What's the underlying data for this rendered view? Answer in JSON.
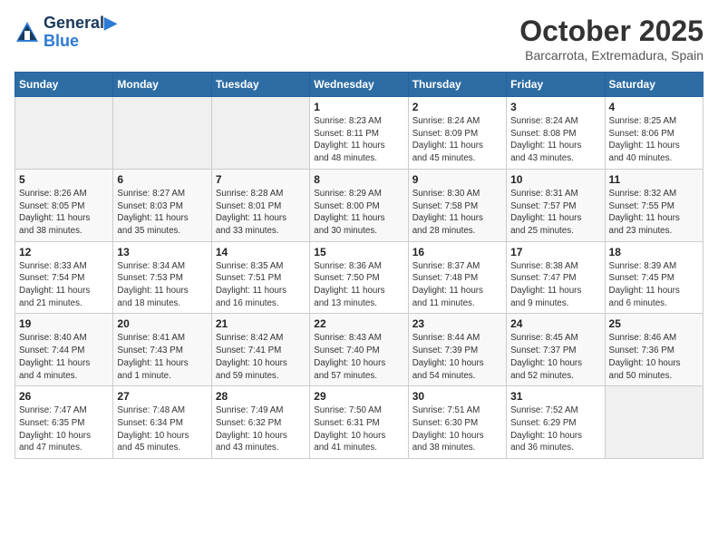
{
  "header": {
    "logo_line1": "General",
    "logo_line2": "Blue",
    "month": "October 2025",
    "location": "Barcarrota, Extremadura, Spain"
  },
  "days_of_week": [
    "Sunday",
    "Monday",
    "Tuesday",
    "Wednesday",
    "Thursday",
    "Friday",
    "Saturday"
  ],
  "weeks": [
    [
      {
        "day": "",
        "info": ""
      },
      {
        "day": "",
        "info": ""
      },
      {
        "day": "",
        "info": ""
      },
      {
        "day": "1",
        "info": "Sunrise: 8:23 AM\nSunset: 8:11 PM\nDaylight: 11 hours\nand 48 minutes."
      },
      {
        "day": "2",
        "info": "Sunrise: 8:24 AM\nSunset: 8:09 PM\nDaylight: 11 hours\nand 45 minutes."
      },
      {
        "day": "3",
        "info": "Sunrise: 8:24 AM\nSunset: 8:08 PM\nDaylight: 11 hours\nand 43 minutes."
      },
      {
        "day": "4",
        "info": "Sunrise: 8:25 AM\nSunset: 8:06 PM\nDaylight: 11 hours\nand 40 minutes."
      }
    ],
    [
      {
        "day": "5",
        "info": "Sunrise: 8:26 AM\nSunset: 8:05 PM\nDaylight: 11 hours\nand 38 minutes."
      },
      {
        "day": "6",
        "info": "Sunrise: 8:27 AM\nSunset: 8:03 PM\nDaylight: 11 hours\nand 35 minutes."
      },
      {
        "day": "7",
        "info": "Sunrise: 8:28 AM\nSunset: 8:01 PM\nDaylight: 11 hours\nand 33 minutes."
      },
      {
        "day": "8",
        "info": "Sunrise: 8:29 AM\nSunset: 8:00 PM\nDaylight: 11 hours\nand 30 minutes."
      },
      {
        "day": "9",
        "info": "Sunrise: 8:30 AM\nSunset: 7:58 PM\nDaylight: 11 hours\nand 28 minutes."
      },
      {
        "day": "10",
        "info": "Sunrise: 8:31 AM\nSunset: 7:57 PM\nDaylight: 11 hours\nand 25 minutes."
      },
      {
        "day": "11",
        "info": "Sunrise: 8:32 AM\nSunset: 7:55 PM\nDaylight: 11 hours\nand 23 minutes."
      }
    ],
    [
      {
        "day": "12",
        "info": "Sunrise: 8:33 AM\nSunset: 7:54 PM\nDaylight: 11 hours\nand 21 minutes."
      },
      {
        "day": "13",
        "info": "Sunrise: 8:34 AM\nSunset: 7:53 PM\nDaylight: 11 hours\nand 18 minutes."
      },
      {
        "day": "14",
        "info": "Sunrise: 8:35 AM\nSunset: 7:51 PM\nDaylight: 11 hours\nand 16 minutes."
      },
      {
        "day": "15",
        "info": "Sunrise: 8:36 AM\nSunset: 7:50 PM\nDaylight: 11 hours\nand 13 minutes."
      },
      {
        "day": "16",
        "info": "Sunrise: 8:37 AM\nSunset: 7:48 PM\nDaylight: 11 hours\nand 11 minutes."
      },
      {
        "day": "17",
        "info": "Sunrise: 8:38 AM\nSunset: 7:47 PM\nDaylight: 11 hours\nand 9 minutes."
      },
      {
        "day": "18",
        "info": "Sunrise: 8:39 AM\nSunset: 7:45 PM\nDaylight: 11 hours\nand 6 minutes."
      }
    ],
    [
      {
        "day": "19",
        "info": "Sunrise: 8:40 AM\nSunset: 7:44 PM\nDaylight: 11 hours\nand 4 minutes."
      },
      {
        "day": "20",
        "info": "Sunrise: 8:41 AM\nSunset: 7:43 PM\nDaylight: 11 hours\nand 1 minute."
      },
      {
        "day": "21",
        "info": "Sunrise: 8:42 AM\nSunset: 7:41 PM\nDaylight: 10 hours\nand 59 minutes."
      },
      {
        "day": "22",
        "info": "Sunrise: 8:43 AM\nSunset: 7:40 PM\nDaylight: 10 hours\nand 57 minutes."
      },
      {
        "day": "23",
        "info": "Sunrise: 8:44 AM\nSunset: 7:39 PM\nDaylight: 10 hours\nand 54 minutes."
      },
      {
        "day": "24",
        "info": "Sunrise: 8:45 AM\nSunset: 7:37 PM\nDaylight: 10 hours\nand 52 minutes."
      },
      {
        "day": "25",
        "info": "Sunrise: 8:46 AM\nSunset: 7:36 PM\nDaylight: 10 hours\nand 50 minutes."
      }
    ],
    [
      {
        "day": "26",
        "info": "Sunrise: 7:47 AM\nSunset: 6:35 PM\nDaylight: 10 hours\nand 47 minutes."
      },
      {
        "day": "27",
        "info": "Sunrise: 7:48 AM\nSunset: 6:34 PM\nDaylight: 10 hours\nand 45 minutes."
      },
      {
        "day": "28",
        "info": "Sunrise: 7:49 AM\nSunset: 6:32 PM\nDaylight: 10 hours\nand 43 minutes."
      },
      {
        "day": "29",
        "info": "Sunrise: 7:50 AM\nSunset: 6:31 PM\nDaylight: 10 hours\nand 41 minutes."
      },
      {
        "day": "30",
        "info": "Sunrise: 7:51 AM\nSunset: 6:30 PM\nDaylight: 10 hours\nand 38 minutes."
      },
      {
        "day": "31",
        "info": "Sunrise: 7:52 AM\nSunset: 6:29 PM\nDaylight: 10 hours\nand 36 minutes."
      },
      {
        "day": "",
        "info": ""
      }
    ]
  ]
}
